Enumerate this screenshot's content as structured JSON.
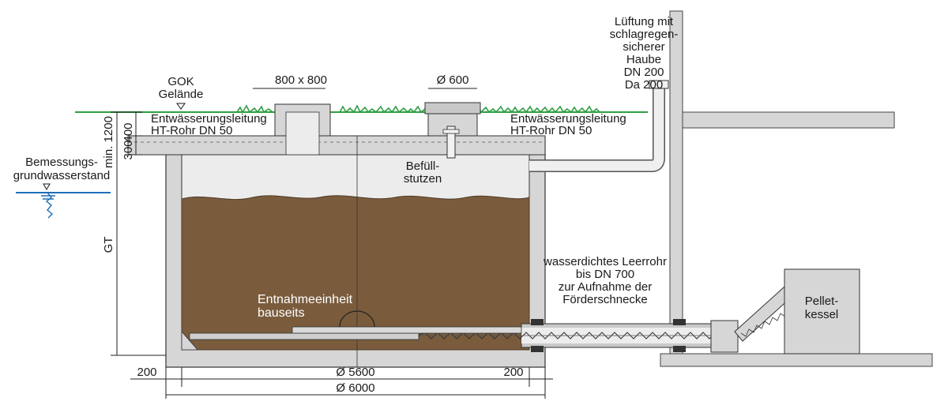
{
  "labels": {
    "gok_line1": "GOK",
    "gok_line2": "Gelände",
    "manhole_square": "800 x 800",
    "manhole_round": "Ø 600",
    "drain_left_1": "Entwässerungsleitung",
    "drain_left_2": "HT-Rohr DN 50",
    "drain_right_1": "Entwässerungsleitung",
    "drain_right_2": "HT-Rohr DN 50",
    "vent_1": "Lüftung mit",
    "vent_2": "schlagregen-",
    "vent_3": "sicherer",
    "vent_4": "Haube",
    "vent_5": "DN 200",
    "vent_6": "Da 200",
    "fill_1": "Befüll-",
    "fill_2": "stutzen",
    "gw_1": "Bemessungs-",
    "gw_2": "grundwasserstand",
    "conduit_1": "wasserdichtes Leerrohr",
    "conduit_2": "bis DN 700",
    "conduit_3": "zur Aufnahme der",
    "conduit_4": "Förderschnecke",
    "extract_1": "Entnahmeeinheit",
    "extract_2": "bauseits",
    "boiler_1": "Pellet-",
    "boiler_2": "kessel"
  },
  "dimensions": {
    "cover_400": "400",
    "min_1200": "min. 1200",
    "slab_300": "300",
    "gt": "GT",
    "wall_left": "200",
    "inner_diameter": "Ø 5600",
    "wall_right": "200",
    "outer_diameter": "Ø 6000"
  },
  "colors": {
    "concrete": "#d6d6d6",
    "concrete_dark": "#b9b9b9",
    "air_space": "#ececec",
    "pellets": "#7a5c3d",
    "grass": "#2ea043",
    "groundwater": "#1f6fb8",
    "line": "#222222"
  }
}
